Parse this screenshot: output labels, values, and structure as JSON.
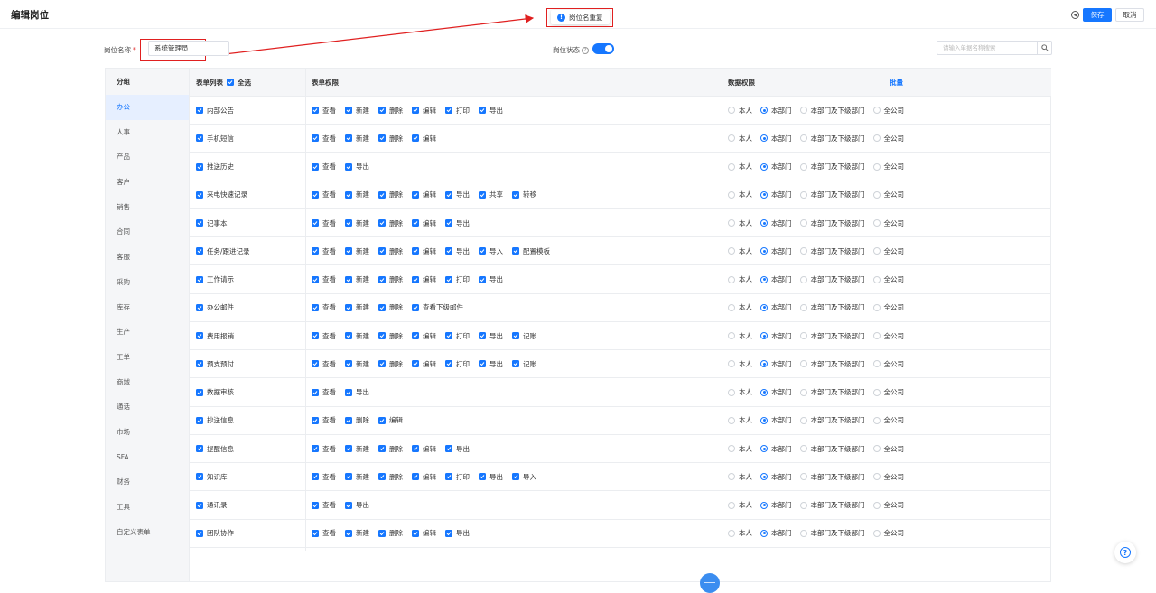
{
  "header": {
    "title": "编辑岗位",
    "toast_text": "岗位名重复",
    "save_label": "保存",
    "cancel_label": "取消"
  },
  "form": {
    "name_label": "岗位名称",
    "required_mark": "*",
    "name_value": "系统管理员",
    "status_label": "岗位状态",
    "status_enabled": true,
    "search_placeholder": "请输入单据名称搜索"
  },
  "groups": {
    "header": "分组",
    "items": [
      "办公",
      "人事",
      "产品",
      "客户",
      "销售",
      "合同",
      "客服",
      "采购",
      "库存",
      "生产",
      "工单",
      "商城",
      "通话",
      "市场",
      "SFA",
      "财务",
      "工具",
      "自定义表单"
    ],
    "active": "办公"
  },
  "table": {
    "col1_header": "表单列表",
    "select_all_label": "全选",
    "col2_header": "表单权限",
    "col3_header": "数据权限",
    "batch_label": "批量",
    "scope_options": [
      "本人",
      "本部门",
      "本部门及下级部门",
      "全公司"
    ],
    "selected_scope": "本部门",
    "rows": [
      {
        "name": "内部公告",
        "perms": [
          "查看",
          "新建",
          "删除",
          "编辑",
          "打印",
          "导出"
        ]
      },
      {
        "name": "手机短信",
        "perms": [
          "查看",
          "新建",
          "删除",
          "编辑"
        ]
      },
      {
        "name": "推送历史",
        "perms": [
          "查看",
          "导出"
        ]
      },
      {
        "name": "来电快速记录",
        "perms": [
          "查看",
          "新建",
          "删除",
          "编辑",
          "导出",
          "共享",
          "转移"
        ]
      },
      {
        "name": "记事本",
        "perms": [
          "查看",
          "新建",
          "删除",
          "编辑",
          "导出"
        ]
      },
      {
        "name": "任务/跟进记录",
        "perms": [
          "查看",
          "新建",
          "删除",
          "编辑",
          "导出",
          "导入",
          "配置模板"
        ]
      },
      {
        "name": "工作请示",
        "perms": [
          "查看",
          "新建",
          "删除",
          "编辑",
          "打印",
          "导出"
        ]
      },
      {
        "name": "办公邮件",
        "perms": [
          "查看",
          "新建",
          "删除",
          "查看下级邮件"
        ]
      },
      {
        "name": "费用报销",
        "perms": [
          "查看",
          "新建",
          "删除",
          "编辑",
          "打印",
          "导出",
          "记账"
        ]
      },
      {
        "name": "预支预付",
        "perms": [
          "查看",
          "新建",
          "删除",
          "编辑",
          "打印",
          "导出",
          "记账"
        ]
      },
      {
        "name": "数据审核",
        "perms": [
          "查看",
          "导出"
        ]
      },
      {
        "name": "抄送信息",
        "perms": [
          "查看",
          "删除",
          "编辑"
        ]
      },
      {
        "name": "提醒信息",
        "perms": [
          "查看",
          "新建",
          "删除",
          "编辑",
          "导出"
        ]
      },
      {
        "name": "知识库",
        "perms": [
          "查看",
          "新建",
          "删除",
          "编辑",
          "打印",
          "导出",
          "导入"
        ]
      },
      {
        "name": "通讯录",
        "perms": [
          "查看",
          "导出"
        ]
      },
      {
        "name": "团队协作",
        "perms": [
          "查看",
          "新建",
          "删除",
          "编辑",
          "导出"
        ]
      }
    ]
  },
  "colors": {
    "accent": "#1677ff",
    "highlight": "#e02020"
  },
  "icons": [
    "info-icon",
    "help-circle-icon",
    "search-icon",
    "checkbox-checked-icon",
    "radio-icon",
    "help-icon",
    "back-icon"
  ]
}
